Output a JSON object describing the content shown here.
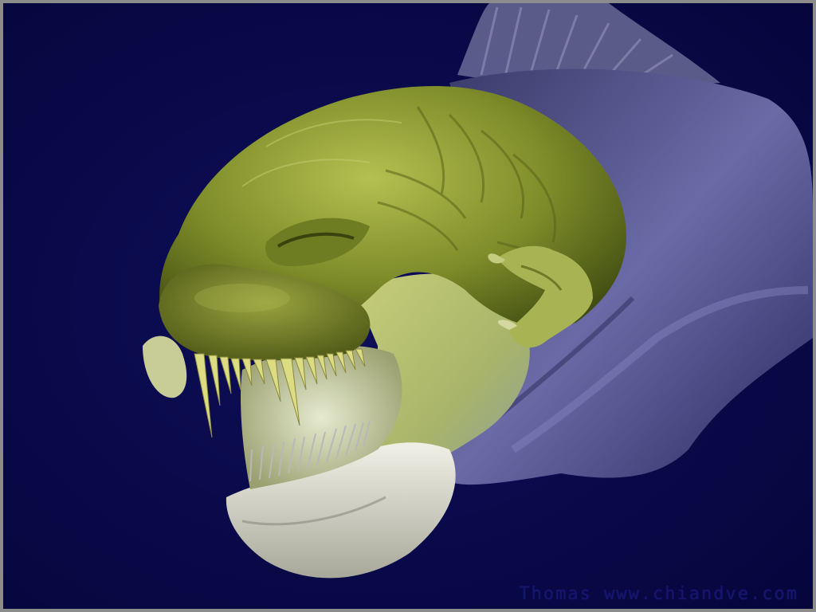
{
  "image": {
    "subject": "3d-sculpted-creature-head",
    "background_color": "#0a0a4a",
    "frame_color": "#8c8c8c",
    "skin_color": "#8a9a30",
    "body_color": "#6a6aa0",
    "jaw_color": "#d8d8d0",
    "teeth_color": "#d8d87a"
  },
  "watermark": {
    "text": "Thomas  www.chiandve.com"
  }
}
